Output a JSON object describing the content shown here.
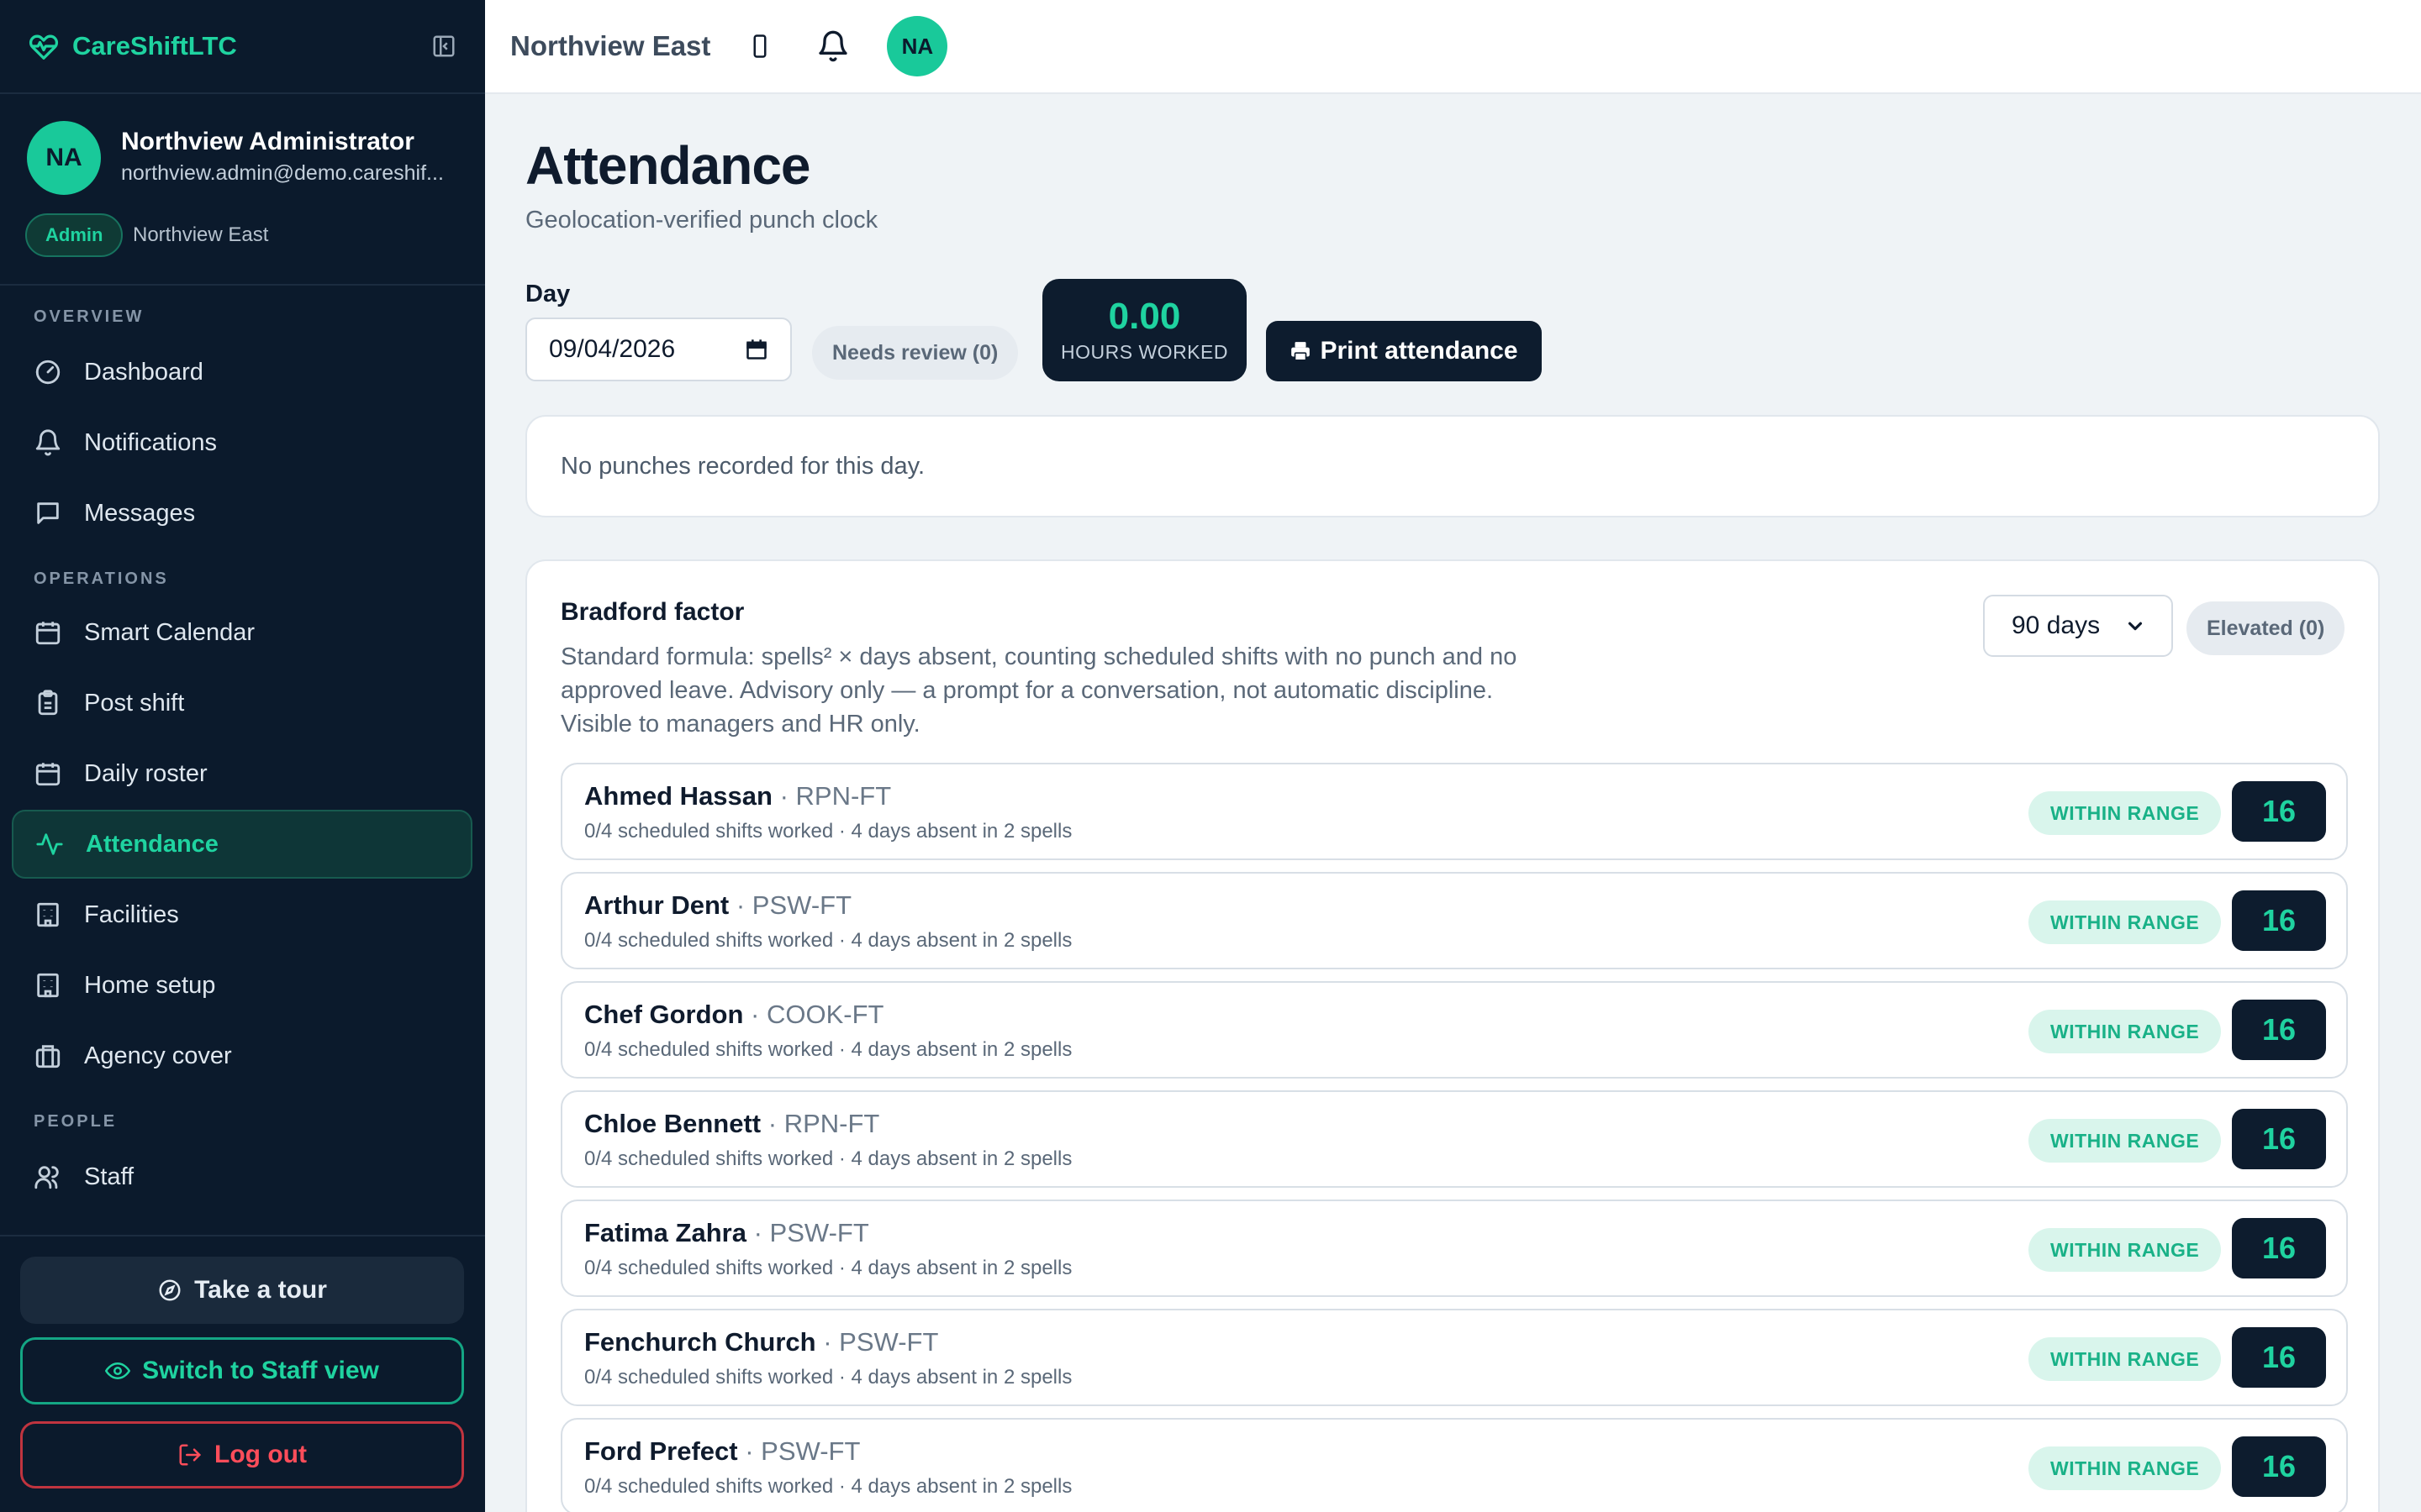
{
  "app": {
    "name": "CareShiftLTC",
    "accent": "#1fd3a0",
    "sidebar_bg": "#0b1a2c"
  },
  "profile": {
    "initials": "NA",
    "name": "Northview Administrator",
    "email": "northview.admin@demo.careshif...",
    "role": "Admin",
    "facility": "Northview East"
  },
  "nav": {
    "sections": {
      "overview": "OVERVIEW",
      "operations": "OPERATIONS",
      "people": "PEOPLE"
    },
    "items": [
      {
        "label": "Dashboard",
        "icon": "gauge-icon"
      },
      {
        "label": "Notifications",
        "icon": "bell-icon"
      },
      {
        "label": "Messages",
        "icon": "message-icon"
      },
      {
        "label": "Smart Calendar",
        "icon": "calendar-icon"
      },
      {
        "label": "Post shift",
        "icon": "clipboard-icon"
      },
      {
        "label": "Daily roster",
        "icon": "calendar-icon"
      },
      {
        "label": "Attendance",
        "icon": "activity-icon",
        "active": true
      },
      {
        "label": "Facilities",
        "icon": "building-icon"
      },
      {
        "label": "Home setup",
        "icon": "building-icon"
      },
      {
        "label": "Agency cover",
        "icon": "briefcase-icon"
      },
      {
        "label": "Staff",
        "icon": "users-icon"
      }
    ]
  },
  "sidebar_actions": {
    "tour": "Take a tour",
    "switch": "Switch to Staff view",
    "logout": "Log out"
  },
  "topbar": {
    "facility": "Northview East",
    "initials": "NA"
  },
  "page": {
    "title": "Attendance",
    "subtitle": "Geolocation-verified punch clock",
    "day_label": "Day",
    "date_value": "09/04/2026",
    "needs_review": "Needs review (0)",
    "hours_value": "0.00",
    "hours_label": "HOURS WORKED",
    "print_label": "Print attendance",
    "no_punches": "No punches recorded for this day."
  },
  "bradford": {
    "title": "Bradford factor",
    "description": "Standard formula: spells² × days absent, counting scheduled shifts with no punch and no approved leave. Advisory only — a prompt for a conversation, not automatic discipline. Visible to managers and HR only.",
    "period": "90 days",
    "elevated": "Elevated (0)",
    "rows": [
      {
        "name": "Ahmed Hassan",
        "role": "RPN-FT",
        "meta": "0/4 scheduled shifts worked · 4 days absent in 2 spells",
        "status": "WITHIN RANGE",
        "score": "16"
      },
      {
        "name": "Arthur Dent",
        "role": "PSW-FT",
        "meta": "0/4 scheduled shifts worked · 4 days absent in 2 spells",
        "status": "WITHIN RANGE",
        "score": "16"
      },
      {
        "name": "Chef Gordon",
        "role": "COOK-FT",
        "meta": "0/4 scheduled shifts worked · 4 days absent in 2 spells",
        "status": "WITHIN RANGE",
        "score": "16"
      },
      {
        "name": "Chloe Bennett",
        "role": "RPN-FT",
        "meta": "0/4 scheduled shifts worked · 4 days absent in 2 spells",
        "status": "WITHIN RANGE",
        "score": "16"
      },
      {
        "name": "Fatima Zahra",
        "role": "PSW-FT",
        "meta": "0/4 scheduled shifts worked · 4 days absent in 2 spells",
        "status": "WITHIN RANGE",
        "score": "16"
      },
      {
        "name": "Fenchurch Church",
        "role": "PSW-FT",
        "meta": "0/4 scheduled shifts worked · 4 days absent in 2 spells",
        "status": "WITHIN RANGE",
        "score": "16"
      },
      {
        "name": "Ford Prefect",
        "role": "PSW-FT",
        "meta": "0/4 scheduled shifts worked · 4 days absent in 2 spells",
        "status": "WITHIN RANGE",
        "score": "16"
      }
    ]
  }
}
